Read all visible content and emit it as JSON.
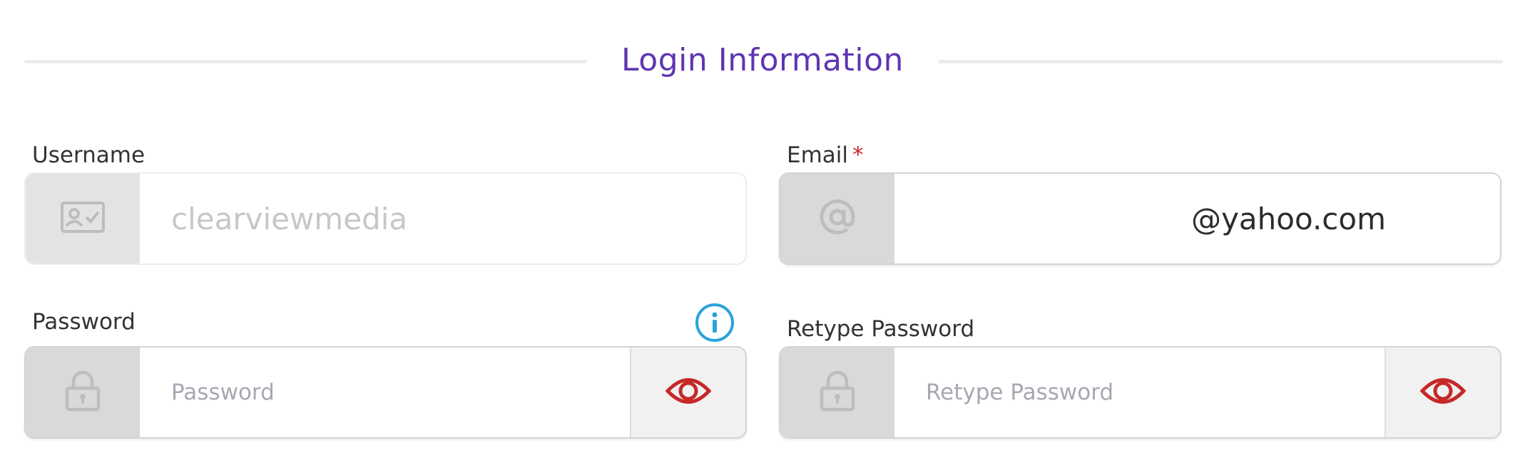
{
  "section": {
    "title": "Login Information"
  },
  "username": {
    "label": "Username",
    "value": "clearviewmedia",
    "icon": "id-card-icon"
  },
  "email": {
    "label": "Email",
    "required_marker": "*",
    "value": "@yahoo.com",
    "icon": "at-icon"
  },
  "password": {
    "label": "Password",
    "placeholder": "Password",
    "icon": "lock-icon",
    "info_icon": "info-icon",
    "toggle_icon": "eye-icon"
  },
  "retype_password": {
    "label": "Retype Password",
    "placeholder": "Retype Password",
    "icon": "lock-icon",
    "toggle_icon": "eye-icon"
  },
  "colors": {
    "accent": "#5e35b1",
    "required": "#c62828",
    "eye": "#c62828",
    "info": "#29a3db",
    "addon": "#d9d9d9"
  }
}
